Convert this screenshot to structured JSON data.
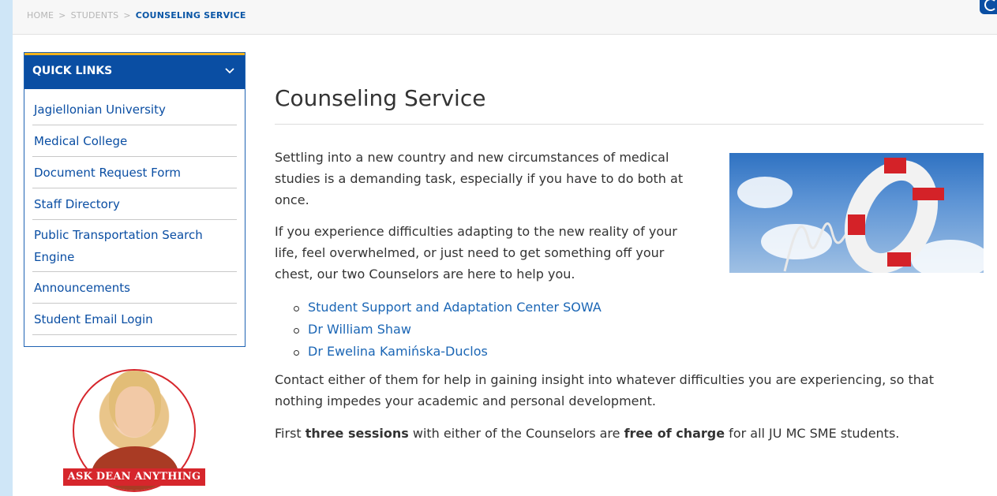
{
  "breadcrumb": {
    "home": "HOME",
    "students": "STUDENTS",
    "current": "COUNSELING SERVICE",
    "separator": ">"
  },
  "sidebar": {
    "title": "QUICK LINKS",
    "items": [
      {
        "label": "Jagiellonian University"
      },
      {
        "label": "Medical College"
      },
      {
        "label": "Document Request Form"
      },
      {
        "label": "Staff Directory"
      },
      {
        "label": "Public Transportation Search Engine"
      },
      {
        "label": "Announcements"
      },
      {
        "label": "Student Email Login"
      }
    ],
    "promo_label": "ASK DEAN ANYTHING"
  },
  "main": {
    "title": "Counseling Service",
    "paragraph1": "Settling into a new country and new circumstances of medical studies is a demanding task, especially if you have to do both at once.",
    "paragraph2": "If you experience difficulties adapting to the new reality of your life, feel overwhelmed, or just need to get something off your chest, our two Counselors are here to help you.",
    "links": [
      {
        "label": "Student Support and Adaptation Center SOWA"
      },
      {
        "label": "Dr William Shaw"
      },
      {
        "label": "Dr Ewelina Kamińska-Duclos"
      }
    ],
    "paragraph3": "Contact either of them for help in gaining insight into whatever difficulties you are experiencing, so that nothing impedes your academic and personal development.",
    "paragraph4": {
      "pre": "First ",
      "bold1": "three sessions",
      "mid": " with either of the Counselors are ",
      "bold2": "free of charge",
      "post": " for all JU MC SME students."
    }
  },
  "colors": {
    "brand_blue": "#0a4ea3",
    "link_blue": "#1b66b5",
    "accent_yellow": "#f2b21b",
    "banner_red": "#d6262c"
  }
}
